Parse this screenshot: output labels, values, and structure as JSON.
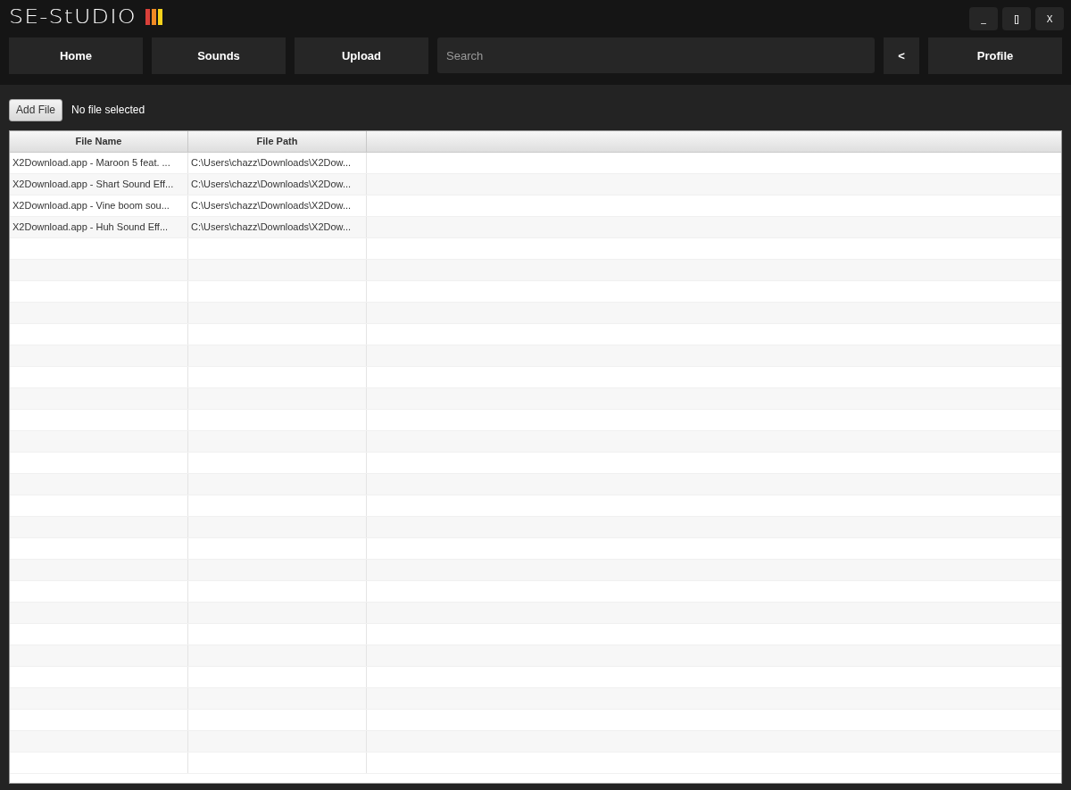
{
  "logo": {
    "text": "SE-StUDIO"
  },
  "window_controls": [
    "_",
    "[]",
    "X"
  ],
  "nav": [
    {
      "label": "Home"
    },
    {
      "label": "Sounds"
    },
    {
      "label": "Upload"
    }
  ],
  "search": {
    "placeholder": "Search"
  },
  "back_button": "<",
  "profile_button": "Profile",
  "add_file": {
    "button": "Add File",
    "status": "No file selected"
  },
  "table": {
    "columns": [
      "File Name",
      "File Path"
    ],
    "rows": [
      {
        "file_name": "X2Download.app - Maroon 5 feat. ...",
        "file_path": "C:\\Users\\chazz\\Downloads\\X2Dow..."
      },
      {
        "file_name": "X2Download.app - Shart Sound Eff...",
        "file_path": "C:\\Users\\chazz\\Downloads\\X2Dow..."
      },
      {
        "file_name": "X2Download.app - Vine boom sou...",
        "file_path": "C:\\Users\\chazz\\Downloads\\X2Dow..."
      },
      {
        "file_name": "X2Download.app - Huh Sound Eff...",
        "file_path": "C:\\Users\\chazz\\Downloads\\X2Dow..."
      }
    ]
  }
}
